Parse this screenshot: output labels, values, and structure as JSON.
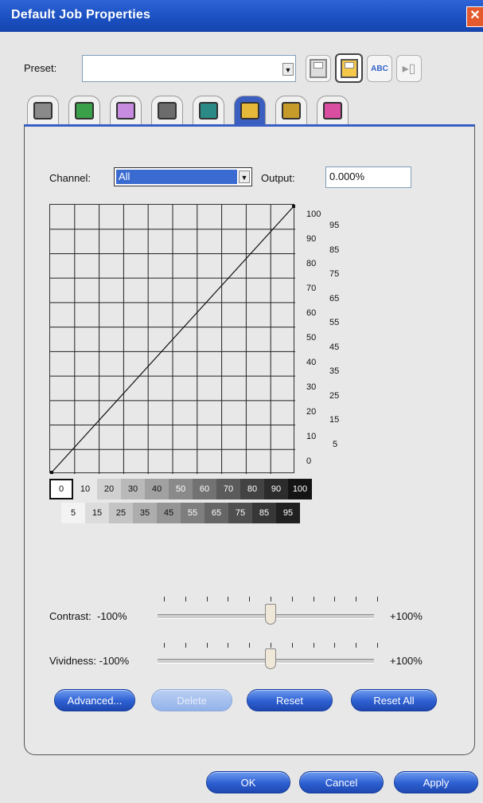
{
  "window": {
    "title": "Default Job Properties",
    "close_glyph": "✕"
  },
  "preset": {
    "label": "Preset:",
    "value": "",
    "dropdown_glyph": "▼"
  },
  "toolbar_icons": [
    "save-disabled-icon",
    "save-icon",
    "rename-abc-icon",
    "delete-trash-icon"
  ],
  "toolbar_abc": "ABC",
  "tabs": [
    {
      "icon": "printer-tab-icon",
      "color": "#8a8a8a"
    },
    {
      "icon": "arrow-tab-icon",
      "color": "#3aa04a"
    },
    {
      "icon": "image-tab-icon",
      "color": "#c78be0"
    },
    {
      "icon": "media-tab-icon",
      "color": "#6c6c6c"
    },
    {
      "icon": "position-tab-icon",
      "color": "#2b8a86"
    },
    {
      "icon": "curves-tab-icon",
      "color": "#e5b83a",
      "active": true
    },
    {
      "icon": "layers-tab-icon",
      "color": "#c79b2a"
    },
    {
      "icon": "color-pen-tab-icon",
      "color": "#d94ea0"
    }
  ],
  "channel": {
    "label": "Channel:",
    "value": "All"
  },
  "output": {
    "label": "Output:",
    "value": "0.000%"
  },
  "curve": {
    "axis_labels_major": [
      "100",
      "90",
      "80",
      "70",
      "60",
      "50",
      "40",
      "30",
      "20",
      "10",
      "0"
    ],
    "axis_labels_minor": [
      "95",
      "85",
      "75",
      "65",
      "55",
      "45",
      "35",
      "25",
      "15",
      "5"
    ],
    "points": [
      [
        0,
        0
      ],
      [
        100,
        100
      ]
    ]
  },
  "swatches_top": [
    "0",
    "10",
    "20",
    "30",
    "40",
    "50",
    "60",
    "70",
    "80",
    "90",
    "100"
  ],
  "swatches_bottom": [
    "5",
    "15",
    "25",
    "35",
    "45",
    "55",
    "65",
    "75",
    "85",
    "95"
  ],
  "contrast": {
    "label": "Contrast:",
    "min": "-100%",
    "max": "+100%",
    "value": 0
  },
  "vividness": {
    "label": "Vividness:",
    "min": "-100%",
    "max": "+100%",
    "value": 0
  },
  "buttons": {
    "advanced": "Advanced...",
    "delete": "Delete",
    "reset": "Reset",
    "reset_all": "Reset All"
  },
  "dialog_buttons": {
    "ok": "OK",
    "cancel": "Cancel",
    "apply": "Apply"
  },
  "colors": {
    "title_bar": "#1a4fc0",
    "button_blue": "#2d5fd1",
    "selection": "#3a6bd0"
  }
}
